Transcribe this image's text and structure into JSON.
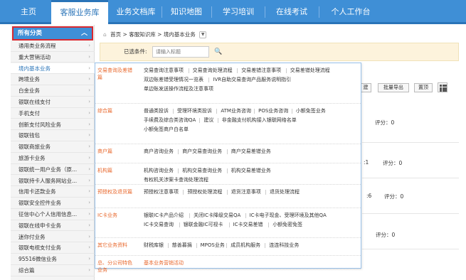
{
  "topnav": {
    "tabs": [
      {
        "label": "主页"
      },
      {
        "label": "客服业务库",
        "active": true
      },
      {
        "label": "业务文档库"
      },
      {
        "label": "知识地图"
      },
      {
        "label": "学习培训"
      },
      {
        "label": "在线考试"
      },
      {
        "label": "个人工作台"
      }
    ]
  },
  "sidebar": {
    "header": "所有分类",
    "items": [
      "通用类业务流程",
      "重大营销活动",
      "境内基本业务",
      "跨境业务",
      "白金业务",
      "银联在线支付",
      "手机支付",
      "创新支付风险业务",
      "银联钱包",
      "银联商旅业务",
      "旅游卡业务",
      "银联统一用户业务（原...",
      "银联持卡人服务网站业...",
      "信用卡还款业务",
      "银联安全控件业务",
      "征信中心个人信用信息...",
      "银联在线申卡业务",
      "迷你付业务",
      "银联电视支付业务",
      "95516微信业务",
      "综合篇"
    ],
    "active_index": 2
  },
  "breadcrumb": {
    "home": "首页",
    "sep1": ">",
    "level2": "客服知识库",
    "sep2": ">",
    "level3": "境内基本业务"
  },
  "filter": {
    "label": "已选条件:",
    "placeholder": "请输入标题"
  },
  "toolbar": {
    "build_label": "建",
    "export_label": "批量导出",
    "reset_label": "置顶"
  },
  "background": {
    "rating1": "评分：0",
    "rating2": "评分：0",
    "rating3": "评分：0",
    "rating4": "评分：0",
    "num1": ":1",
    "num2": ":6"
  },
  "panel": {
    "rows": [
      {
        "category": "交易查询及差错篇",
        "lines": [
          [
            "交易查询注意事项",
            "交易查询处理流程",
            "交易差错注意事项",
            "交易差错处理流程"
          ],
          [
            "双边账差错受理情况一览表",
            "IVR自助交易查询产品服务说明指引"
          ],
          [
            "单边账发送操作流程及注意事项"
          ]
        ]
      },
      {
        "category": "综合篇",
        "lines": [
          [
            "普通类投诉",
            "受理环境类投诉",
            "ATM业务咨询",
            "POS业务咨询",
            "小额免签业务"
          ],
          [
            "手续费及综合类咨询QA",
            "建议",
            "非金融支付机构接入银联网络名单"
          ],
          [
            "小额免签商户白名单"
          ]
        ]
      },
      {
        "category": "商户篇",
        "lines": [
          [
            "商户咨询业务",
            "商户交易查询业务",
            "商户交易差错业务"
          ]
        ]
      },
      {
        "category": "机构篇",
        "lines": [
          [
            "机构咨询业务",
            "机构交易查询业务",
            "机构交易差错业务"
          ],
          [
            "有权机关涉案卡查询处理流程"
          ]
        ]
      },
      {
        "category": "预授权及退货篇",
        "lines": [
          [
            "预授权注意事项",
            "预授权处理流程",
            "退货注意事项",
            "退货处理流程"
          ]
        ]
      },
      {
        "category": "IC卡业务",
        "lines": [
          [
            "银联IC卡产品介绍",
            "关闭IC卡降级交易QA",
            "IC卡电子现金、受理环境及其他QA"
          ],
          [
            "IC卡交易查询",
            "银联金融IC可视卡",
            "IC卡交易差错",
            "小额免密免签"
          ]
        ]
      },
      {
        "category": "其它业务资料",
        "lines": [
          [
            "财税库银",
            "慈善募捐",
            "MPOS业务",
            "成员机构服务",
            "连连科技业务"
          ]
        ]
      },
      {
        "category": "总、分公司特色业务",
        "lines": [
          [
            "基本业务营销活动"
          ]
        ]
      }
    ]
  },
  "colors": {
    "nav_blue": "#3f8fd6",
    "accent_orange": "#e8672b",
    "highlight_red": "#d9282f"
  }
}
